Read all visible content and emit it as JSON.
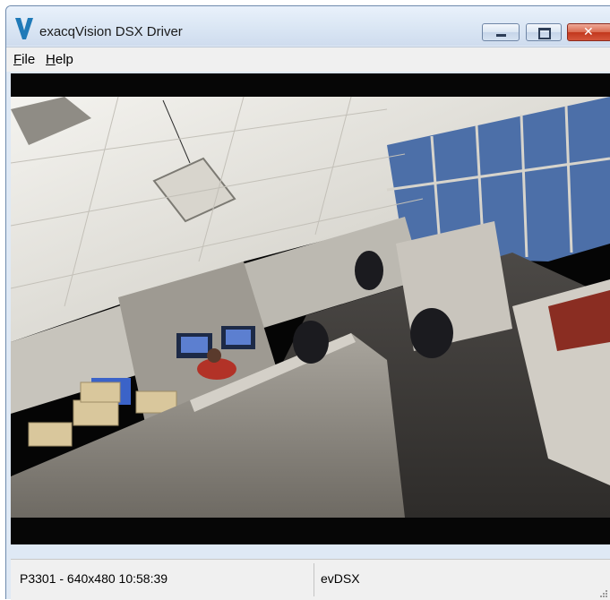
{
  "window": {
    "title": "exacqVision DSX Driver",
    "icon": "v-logo-icon",
    "accent": "#1f7ab8",
    "controls": [
      "minimize-icon",
      "maximize-icon",
      "close-icon"
    ]
  },
  "menu": {
    "file": {
      "accel": "F",
      "rest": "ile"
    },
    "help": {
      "accel": "H",
      "rest": "elp"
    }
  },
  "video": {
    "description_icon": "camera-feed"
  },
  "status": {
    "left": "P3301 - 640x480 10:58:39",
    "right": "evDSX"
  }
}
